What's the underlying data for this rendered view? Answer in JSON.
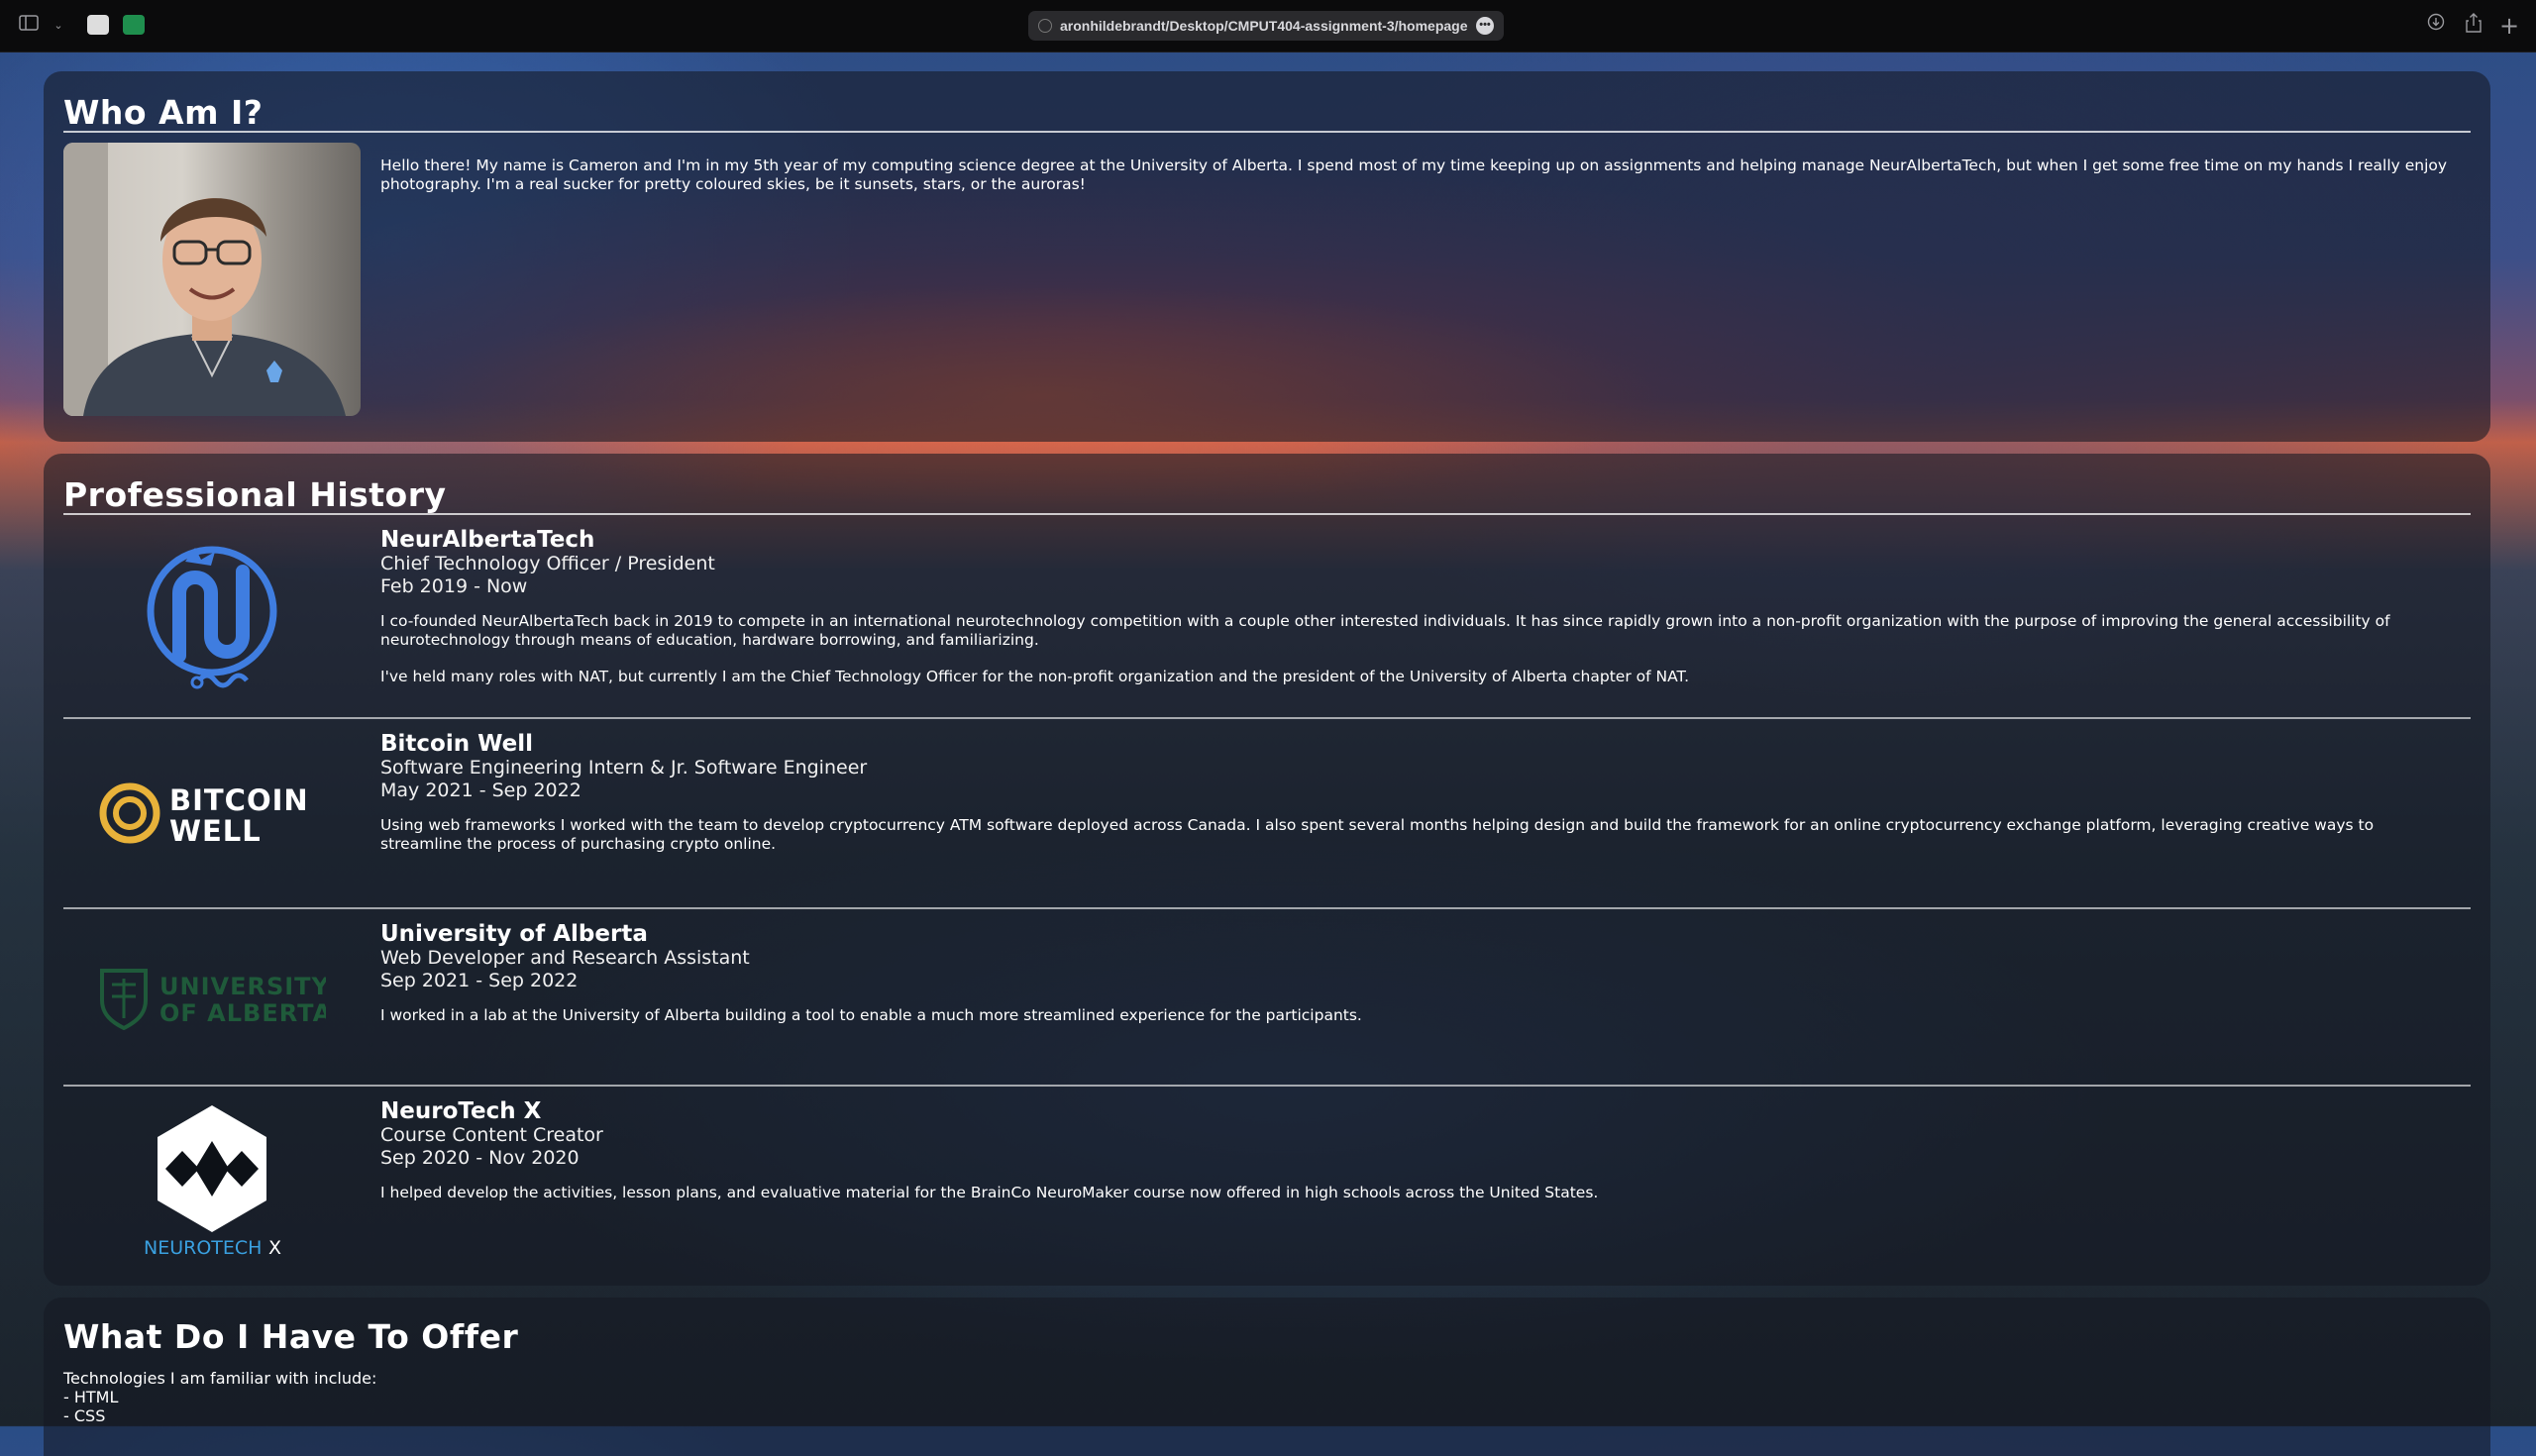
{
  "browser": {
    "url": "aronhildebrandt/Desktop/CMPUT404-assignment-3/homepage.html"
  },
  "about": {
    "heading": "Who Am I?",
    "text": "Hello there! My name is Cameron and I'm in my 5th year of my computing science degree at the University of Alberta. I spend most of my time keeping up on assignments and helping manage NeurAlbertaTech, but when I get some free time on my hands I really enjoy photography. I'm a real sucker for pretty coloured skies, be it sunsets, stars, or the auroras!"
  },
  "history": {
    "heading": "Professional History",
    "jobs": [
      {
        "company": "NeurAlbertaTech",
        "role": "Chief Technology Officer / President",
        "dates": "Feb 2019 - Now",
        "paragraphs": [
          "I co-founded NeurAlbertaTech back in 2019 to compete in an international neurotechnology competition with a couple other interested individuals. It has since rapidly grown into a non-profit organization with the purpose of improving the general accessibility of neurotechnology through means of education, hardware borrowing, and familiarizing.",
          "I've held many roles with NAT, but currently I am the Chief Technology Officer for the non-profit organization and the president of the University of Alberta chapter of NAT."
        ]
      },
      {
        "company": "Bitcoin Well",
        "role": "Software Engineering Intern & Jr. Software Engineer",
        "dates": "May 2021 - Sep 2022",
        "paragraphs": [
          "Using web frameworks I worked with the team to develop cryptocurrency ATM software deployed across Canada. I also spent several months helping design and build the framework for an online cryptocurrency exchange platform, leveraging creative ways to streamline the process of purchasing crypto online."
        ],
        "logo_text": [
          "BITCOIN",
          "WELL"
        ]
      },
      {
        "company": "University of Alberta",
        "role": "Web Developer and Research Assistant",
        "dates": "Sep 2021 - Sep 2022",
        "paragraphs": [
          "I worked in a lab at the University of Alberta building a tool to enable a much more streamlined experience for the participants."
        ],
        "logo_text": [
          "UNIVERSITY",
          "OF ALBERTA"
        ]
      },
      {
        "company": "NeuroTech X",
        "role": "Course Content Creator",
        "dates": "Sep 2020 - Nov 2020",
        "paragraphs": [
          "I helped develop the activities, lesson plans, and evaluative material for the BrainCo NeuroMaker course now offered in high schools across the United States."
        ],
        "logo_text": [
          "NEUROTECH",
          "X"
        ]
      }
    ]
  },
  "offer": {
    "heading": "What Do I Have To Offer",
    "intro": "Technologies I am familiar with include:",
    "items": [
      "- HTML",
      "- CSS"
    ]
  },
  "colors": {
    "nat_blue": "#3f7de0",
    "bitcoin_gold": "#e8b23a",
    "ualberta_green": "#1f5a3a",
    "ntx_blue": "#3aa0e0"
  }
}
